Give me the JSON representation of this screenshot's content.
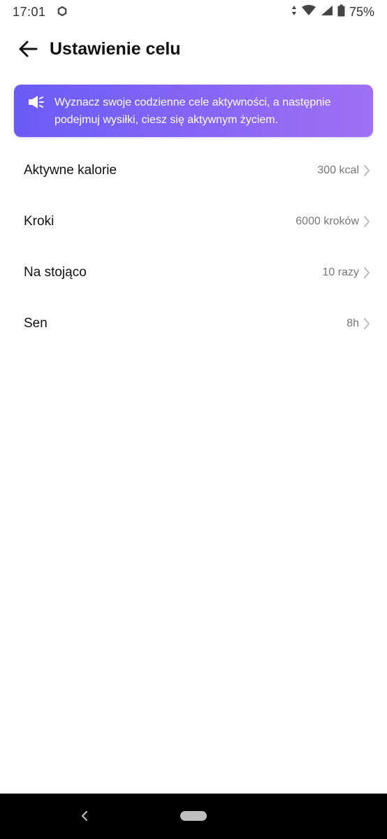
{
  "status_bar": {
    "time": "17:01",
    "battery": "75%",
    "icons": [
      "settings-gear-icon",
      "data-arrows-icon",
      "wifi-icon",
      "signal-icon",
      "battery-icon"
    ]
  },
  "header": {
    "title": "Ustawienie celu",
    "back_icon": "arrow-left-icon"
  },
  "banner": {
    "icon": "megaphone-icon",
    "text": "Wyznacz swoje codzienne cele aktywności, a następnie podejmuj wysiłki, ciesz się aktywnym życiem.",
    "gradient_start": "#6a5cf6",
    "gradient_end": "#a070f2"
  },
  "goals": [
    {
      "label": "Aktywne kalorie",
      "value": "300 kcal"
    },
    {
      "label": "Kroki",
      "value": "6000 kroków"
    },
    {
      "label": "Na stojąco",
      "value": "10 razy"
    },
    {
      "label": "Sen",
      "value": "8h"
    }
  ],
  "nav_bar": {
    "back_icon": "nav-back-icon",
    "home_icon": "home-pill-icon"
  }
}
